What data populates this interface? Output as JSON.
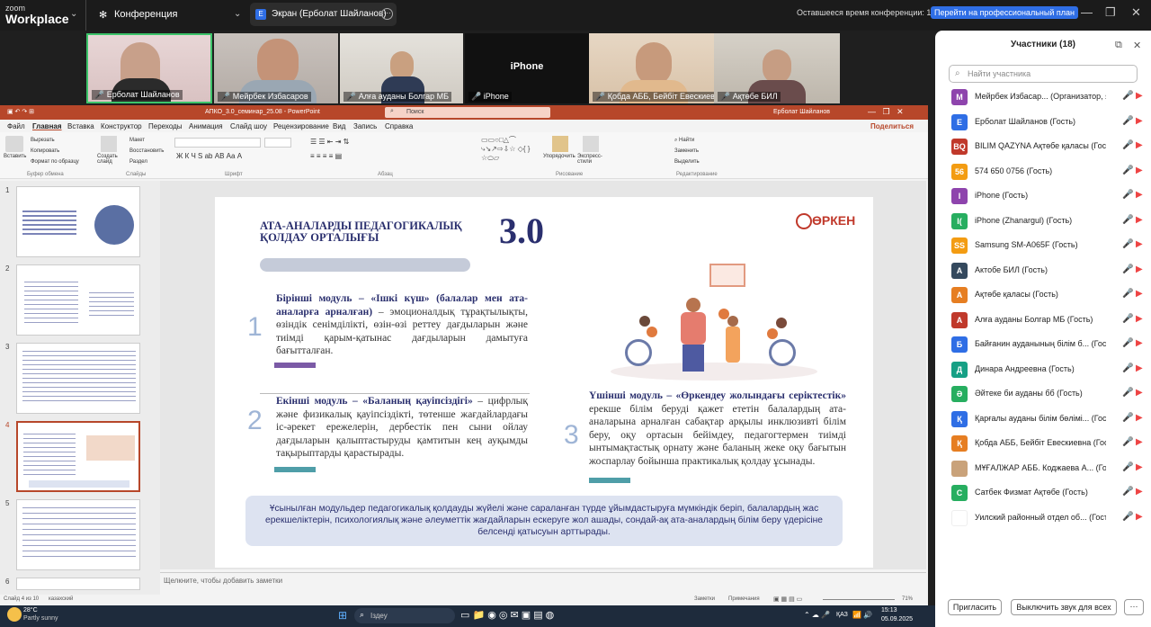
{
  "zoom": {
    "logo1": "zoom",
    "logo2": "Workplace",
    "conference": "Конференция",
    "share_tab": "Экран (Ерболат Шайланов)",
    "time_left": "Оставшееся время конференции: 14:07",
    "upgrade": "Перейти на профессиональный план"
  },
  "videos": [
    {
      "name": "Ерболат Шайланов"
    },
    {
      "name": "Мейрбек Избасаров"
    },
    {
      "name": "Алға ауданы Болгар МБ"
    },
    {
      "name": "iPhone",
      "center": "iPhone"
    },
    {
      "name": "Қобда АББ, Бейбіт Евескиевна"
    },
    {
      "name": "Ақтөбе БИЛ"
    }
  ],
  "ppt": {
    "title": "АПКО_3.0_семинар_25.08  -  PowerPoint",
    "search": "Поиск",
    "user": "Ерболат Шайланов",
    "share": "Поделиться",
    "tabs": [
      "Файл",
      "Главная",
      "Вставка",
      "Конструктор",
      "Переходы",
      "Анимация",
      "Слайд шоу",
      "Рецензирование",
      "Вид",
      "Запись",
      "Справка"
    ],
    "ribbon": {
      "paste": "Вставить",
      "cut": "Вырезать",
      "copy": "Копировать",
      "format": "Формат по образцу",
      "clipboard": "Буфер обмена",
      "new_slide": "Создать слайд",
      "layout": "Макет",
      "reset": "Восстановить",
      "section": "Раздел",
      "slides": "Слайды",
      "font": "Шрифт",
      "paragraph": "Абзац",
      "drawing": "Рисование",
      "arrange": "Упорядочить",
      "quick": "Экспресс-стили",
      "find": "Найти",
      "replace": "Заменить",
      "select": "Выделить",
      "editing": "Редактирование"
    },
    "notes": "Щелкните, чтобы добавить заметки",
    "status": {
      "slide": "Слайд 4 из 10",
      "lang": "казахский",
      "notes_btn": "Заметки",
      "comments_btn": "Примечания",
      "zoom": "71%"
    }
  },
  "slide": {
    "title": "АТА-АНАЛАРДЫ ПЕДАГОГИКАЛЫҚ ҚОЛДАУ ОРТАЛЫҒЫ",
    "version": "3.0",
    "logo": "ӨРКЕН",
    "m1_num": "1",
    "m1_head": "Бірінші модуль – «Ішкі күш» (балалар мен ата-аналарға арналған)",
    "m1_text": "– эмоционалдық тұрақтылықты, өзіндік сенімділікті, өзін-өзі реттеу дағдыларын және тиімді қарым-қатынас дағдыларын дамытуға бағытталған.",
    "m2_num": "2",
    "m2_head": "Екінші модуль – «Баланың қауіпсіздігі»",
    "m2_text": "– цифрлық және физикалық қауіпсіздікті, төтенше жағдайлардағы іс-әрекет ережелерін, дербестік пен сыни ойлау дағдыларын қалыптастыруды қамтитын кең ауқымды тақырыптарды қарастырады.",
    "m3_num": "3",
    "m3_head": "Үшінші модуль – «Өркендеу жолындағы серіктестік»",
    "m3_text": "ерекше білім беруді қажет ететін балалардың ата-аналарына арналған сабақтар арқылы инклюзивті білім беру, оқу ортасын бейімдеу, педагогтермен тиімді ынтымақтастық орнату және баланың жеке оқу бағытын жоспарлау бойынша практикалық қолдау ұсынады.",
    "summary": "Ұсынылған модульдер педагогикалық қолдауды жүйелі және сараланған түрде ұйымдастыруға мүмкіндік беріп, балалардың жас ерекшеліктерін, психологиялық және әлеуметтік жағдайларын ескеруге жол ашады, сондай-ақ ата-аналардың білім беру үдерісіне белсенді қатысуын арттырады."
  },
  "taskbar": {
    "weather_temp": "28°C",
    "weather_desc": "Partly sunny",
    "search": "Іздеу",
    "lang": "ҚАЗ",
    "time": "15:13",
    "date": "05.09.2025"
  },
  "participants": {
    "title": "Участники (18)",
    "search_placeholder": "Найти участника",
    "invite": "Пригласить",
    "mute_all": "Выключить звук для всех",
    "list": [
      {
        "initials": "М",
        "color": "#8e44ad",
        "name": "Мейрбек Избасар... (Организатор, я)"
      },
      {
        "initials": "Е",
        "color": "#2f6ee5",
        "name": "Ерболат Шайланов (Гость)"
      },
      {
        "initials": "BQ",
        "color": "#c0392b",
        "name": "BILIM QAZYNA Ақтөбе қаласы (Гость)"
      },
      {
        "initials": "56",
        "color": "#f39c12",
        "name": "574 650 0756 (Гость)"
      },
      {
        "initials": "I",
        "color": "#8e44ad",
        "name": "iPhone (Гость)"
      },
      {
        "initials": "I(",
        "color": "#27ae60",
        "name": "iPhone (Zhanargul) (Гость)"
      },
      {
        "initials": "SS",
        "color": "#f39c12",
        "name": "Samsung SM-A065F (Гость)"
      },
      {
        "initials": "А",
        "color": "#34495e",
        "name": "Актобе БИЛ (Гость)"
      },
      {
        "initials": "А",
        "color": "#e67e22",
        "name": "Ақтөбе қаласы (Гость)"
      },
      {
        "initials": "А",
        "color": "#c0392b",
        "name": "Алға ауданы Болгар МБ (Гость)"
      },
      {
        "initials": "Б",
        "color": "#2f6ee5",
        "name": "Байғанин ауданының білім б... (Гость)"
      },
      {
        "initials": "Д",
        "color": "#16a085",
        "name": "Динара Андреевна (Гость)"
      },
      {
        "initials": "Ә",
        "color": "#27ae60",
        "name": "Әйтеке би ауданы бб (Гость)"
      },
      {
        "initials": "Қ",
        "color": "#2f6ee5",
        "name": "Қарғалы ауданы білім бөлімі... (Гость)"
      },
      {
        "initials": "Қ",
        "color": "#e67e22",
        "name": "Қобда АББ, Бейбіт Евескиевна (Гость)"
      },
      {
        "initials": "",
        "color": "#c9a27a",
        "name": "МҰҒАЛЖАР АББ. Коджаева А... (Гость)"
      },
      {
        "initials": "С",
        "color": "#27ae60",
        "name": "Сатбек Физмат Ақтөбе (Гость)"
      },
      {
        "initials": "",
        "color": "#ffffff",
        "name": "Уилский районный отдел об... (Гость)"
      }
    ]
  }
}
